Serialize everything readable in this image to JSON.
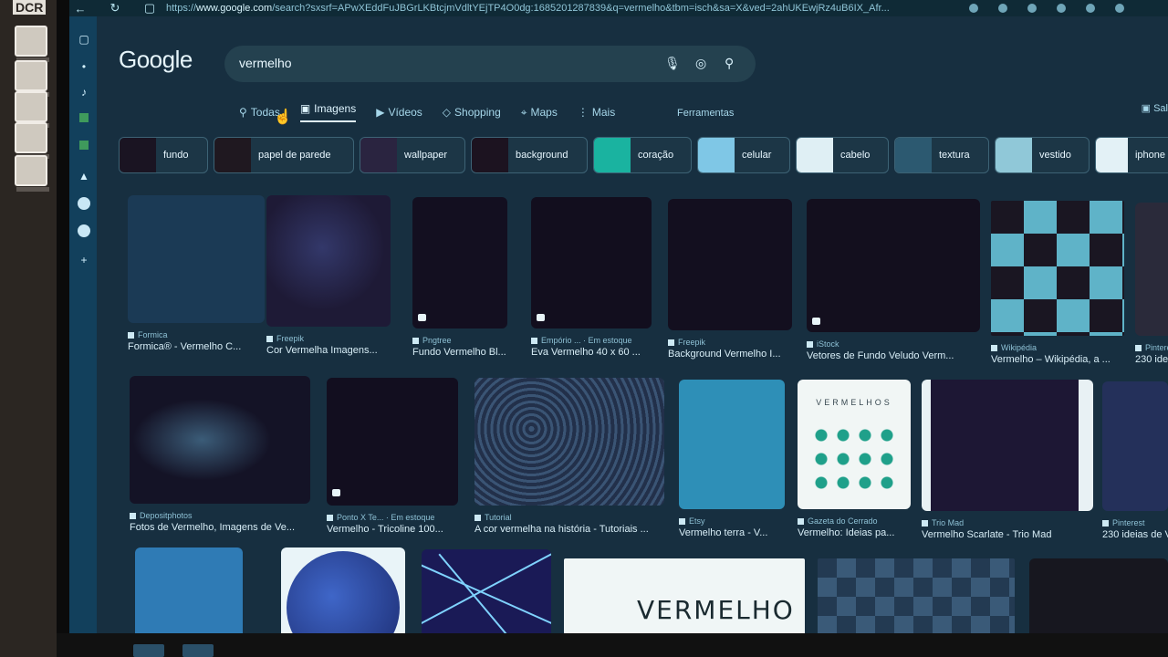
{
  "browser": {
    "url": "https://www.google.com/search?sxsrf=APwXEddFuJBGrLKBtcjmVdltYEjTP4O0dg:1685201287839&q=vermelho&tbm=isch&sa=X&ved=2ahUKEwjRz4uB6IX_Afr...",
    "url_bold_part": "www.google.com"
  },
  "desktop": {
    "dcr_label": "DCR"
  },
  "google": {
    "logo": "Google",
    "query": "vermelho",
    "tabs": [
      {
        "icon": "search-icon",
        "glyph": "⚲",
        "label": "Todas"
      },
      {
        "icon": "image-icon",
        "glyph": "▣",
        "label": "Imagens"
      },
      {
        "icon": "video-icon",
        "glyph": "▶",
        "label": "Vídeos"
      },
      {
        "icon": "tag-icon",
        "glyph": "◇",
        "label": "Shopping"
      },
      {
        "icon": "map-pin-icon",
        "glyph": "⌖",
        "label": "Maps"
      },
      {
        "icon": "more-icon",
        "glyph": "⋮",
        "label": "Mais"
      }
    ],
    "tools": "Ferramentas",
    "safesearch": "Sal"
  },
  "chips": [
    {
      "label": "fundo",
      "color": "#1a1422"
    },
    {
      "label": "papel de parede",
      "color": "#1f1820"
    },
    {
      "label": "wallpaper",
      "color": "#2a2440"
    },
    {
      "label": "background",
      "color": "#1c1320"
    },
    {
      "label": "coração",
      "color": "#1ab3a0"
    },
    {
      "label": "celular",
      "color": "#7fc7e6"
    },
    {
      "label": "cabelo",
      "color": "#dfeff4"
    },
    {
      "label": "textura",
      "color": "#2c5970"
    },
    {
      "label": "vestido",
      "color": "#90c8d8"
    },
    {
      "label": "iphone",
      "color": "#e3f1f6"
    }
  ],
  "results_row1": [
    {
      "source": "Formica",
      "title": "Formica® - Vermelho C...",
      "color": "#1b3a55"
    },
    {
      "source": "Freepik",
      "title": "Cor Vermelha Imagens...",
      "color": "#1e1a36"
    },
    {
      "source": "Pngtree",
      "title": "Fundo Vermelho Bl...",
      "color": "#130f20"
    },
    {
      "source": "Empório ... · Em estoque",
      "title": "Eva Vermelho 40 x 60 ...",
      "color": "#120e1e"
    },
    {
      "source": "Freepik",
      "title": "Background Vermelho I...",
      "color": "#130f1f"
    },
    {
      "source": "iStock",
      "title": "Vetores de Fundo Veludo Verm...",
      "color": "#130f1e"
    },
    {
      "source": "Wikipédia",
      "title": "Vermelho – Wikipédia, a ...",
      "color": "#5fb3c8"
    },
    {
      "source": "Pinterest",
      "title": "230 ide...",
      "color": "#2a2a3a"
    }
  ],
  "results_row2": [
    {
      "source": "Depositphotos",
      "title": "Fotos de Vermelho, Imagens de Ve...",
      "color": "#141326"
    },
    {
      "source": "Ponto X Te... · Em estoque",
      "title": "Vermelho - Tricoline 100...",
      "color": "#120e1f"
    },
    {
      "source": "Tutorial",
      "title": "A cor vermelha na história - Tutoriais ...",
      "color": "#2a3c5a"
    },
    {
      "source": "Etsy",
      "title": "Vermelho terra - V...",
      "color": "#2e8fb7"
    },
    {
      "source": "Gazeta do Cerrado",
      "title": "Vermelho: Ideias pa...",
      "color": "#f1f6f5"
    },
    {
      "source": "Trio Mad",
      "title": "Vermelho Scarlate - Trio Mad",
      "color": "#1d1734"
    },
    {
      "source": "Pinterest",
      "title": "230 ideias de V...",
      "color": "#24305a"
    }
  ],
  "palette_card": {
    "title": "VERMELHOS"
  },
  "results_row3": [
    {
      "color": "#2f7bb5"
    },
    {
      "color": "#e9f4f8"
    },
    {
      "color": "#1a1a56"
    },
    {
      "color": "#f0f6f6",
      "text": "VERMELHO"
    },
    {
      "color": "#3a5a78"
    },
    {
      "color": "#17171f"
    }
  ]
}
